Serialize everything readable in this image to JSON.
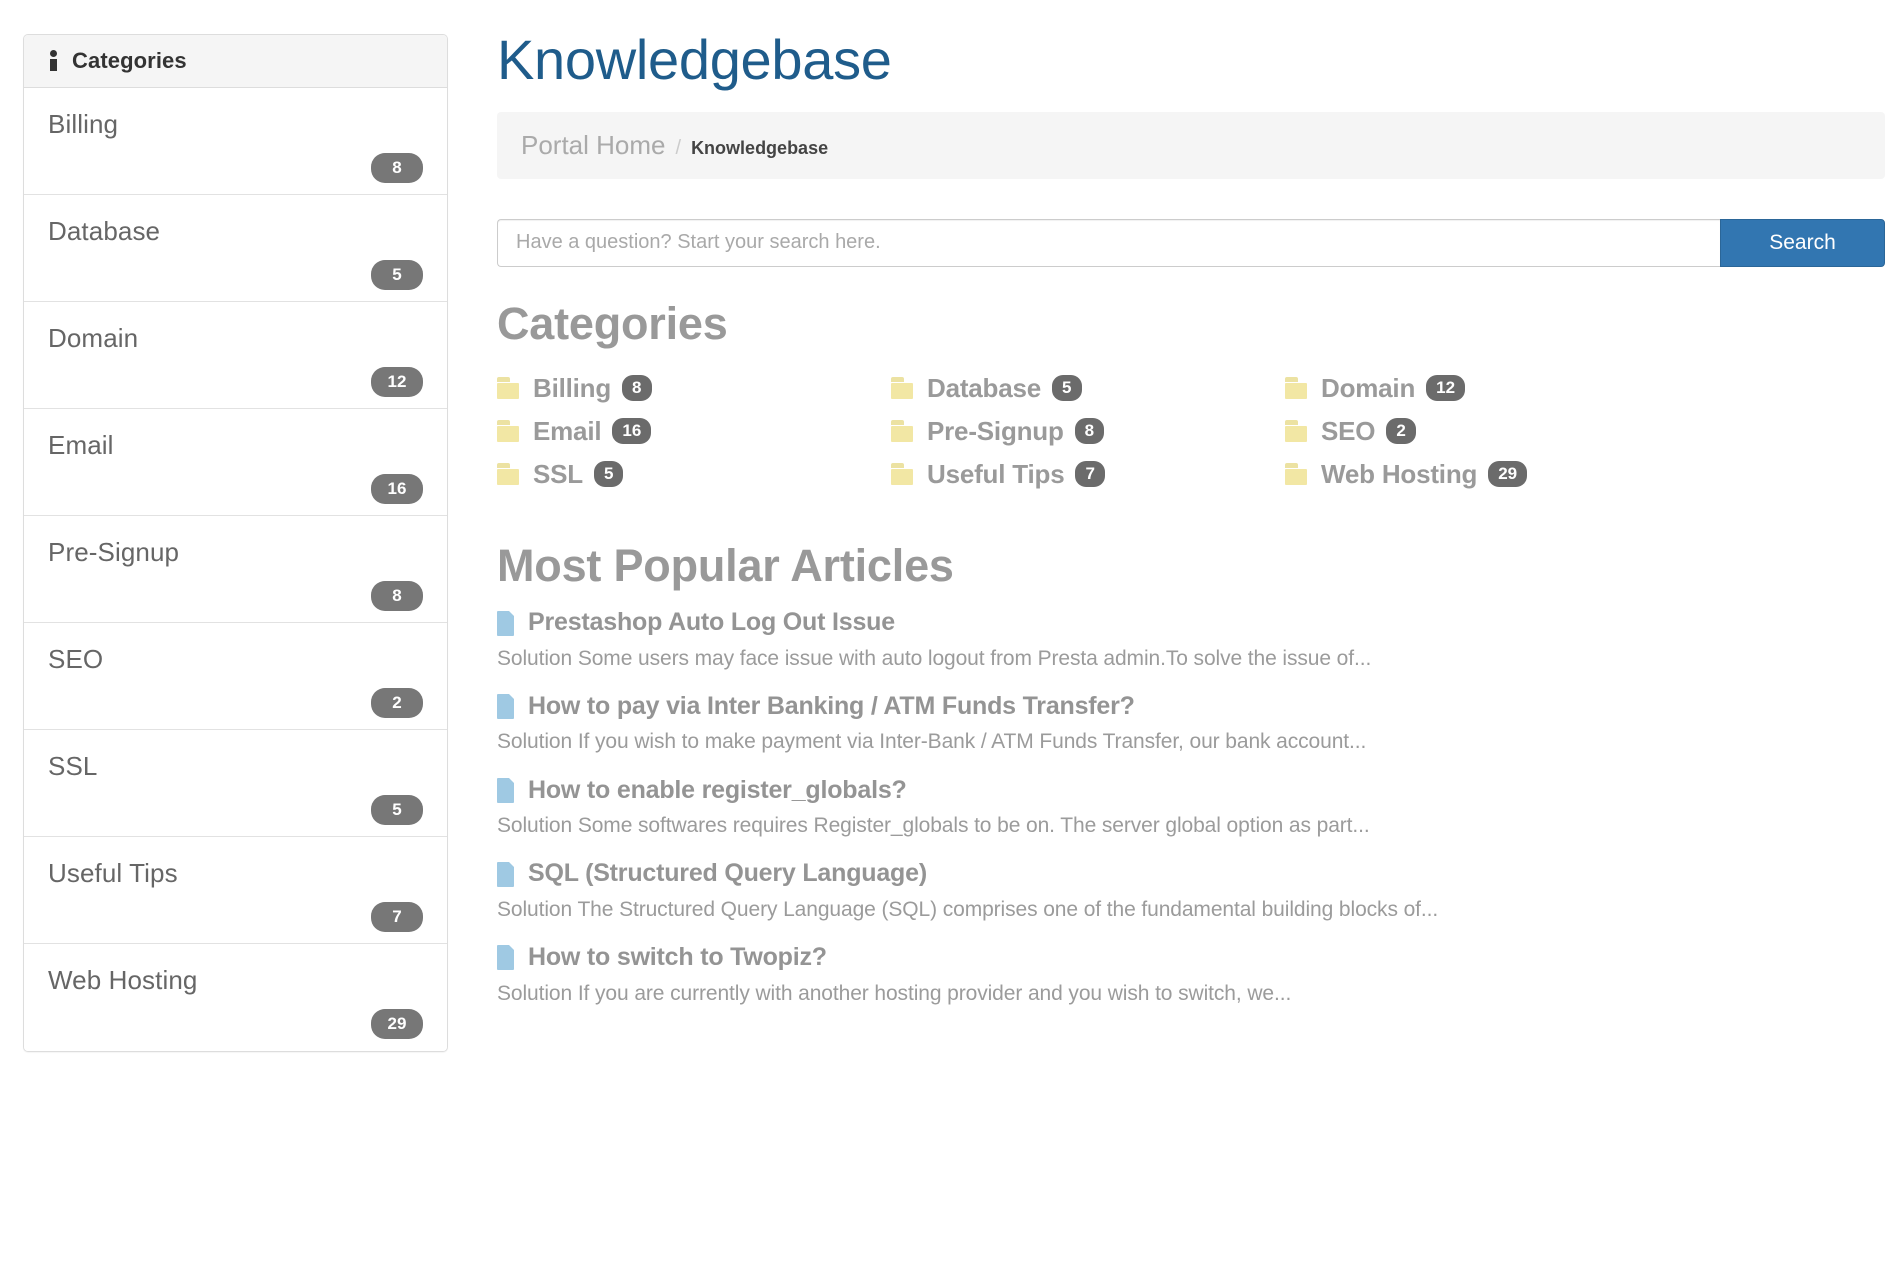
{
  "sidebar": {
    "header_label": "Categories",
    "header_icon": "info-icon",
    "items": [
      {
        "label": "Billing",
        "count": "8"
      },
      {
        "label": "Database",
        "count": "5"
      },
      {
        "label": "Domain",
        "count": "12"
      },
      {
        "label": "Email",
        "count": "16"
      },
      {
        "label": "Pre-Signup",
        "count": "8"
      },
      {
        "label": "SEO",
        "count": "2"
      },
      {
        "label": "SSL",
        "count": "5"
      },
      {
        "label": "Useful Tips",
        "count": "7"
      },
      {
        "label": "Web Hosting",
        "count": "29"
      }
    ]
  },
  "header": {
    "title": "Knowledgebase"
  },
  "breadcrumb": {
    "home_label": "Portal Home",
    "separator": "/",
    "current_label": "Knowledgebase"
  },
  "search": {
    "placeholder": "Have a question? Start your search here.",
    "value": "",
    "button_label": "Search"
  },
  "categories_section": {
    "title": "Categories",
    "items": [
      {
        "label": "Billing",
        "count": "8",
        "icon": "folder-icon"
      },
      {
        "label": "Database",
        "count": "5",
        "icon": "folder-icon"
      },
      {
        "label": "Domain",
        "count": "12",
        "icon": "folder-icon"
      },
      {
        "label": "Email",
        "count": "16",
        "icon": "folder-icon"
      },
      {
        "label": "Pre-Signup",
        "count": "8",
        "icon": "folder-icon"
      },
      {
        "label": "SEO",
        "count": "2",
        "icon": "folder-icon"
      },
      {
        "label": "SSL",
        "count": "5",
        "icon": "folder-icon"
      },
      {
        "label": "Useful Tips",
        "count": "7",
        "icon": "folder-icon"
      },
      {
        "label": "Web Hosting",
        "count": "29",
        "icon": "folder-icon"
      }
    ]
  },
  "articles_section": {
    "title": "Most Popular Articles",
    "items": [
      {
        "title": "Prestashop Auto Log Out Issue",
        "excerpt": "Solution Some users may face issue with auto logout from Presta admin.To solve the issue of..."
      },
      {
        "title": "How to pay via Inter Banking / ATM Funds Transfer?",
        "excerpt": "Solution If you wish to make payment via Inter-Bank / ATM Funds Transfer, our bank account..."
      },
      {
        "title": "How to enable register_globals?",
        "excerpt": "Solution Some softwares requires Register_globals to be on. The server global option as part..."
      },
      {
        "title": "SQL (Structured Query Language)",
        "excerpt": "Solution The Structured Query Language (SQL) comprises one of the fundamental building blocks of..."
      },
      {
        "title": "How to switch to Twopiz?",
        "excerpt": "Solution If you are currently with another hosting provider and you wish to switch, we..."
      }
    ]
  },
  "colors": {
    "title_blue": "#1f5c8b",
    "search_button_blue": "#3276b1",
    "badge_gray": "#6b6b6b",
    "folder_yellow": "#f2e7a4",
    "file_blue": "#9fc9e3",
    "heading_gray": "#999999"
  }
}
